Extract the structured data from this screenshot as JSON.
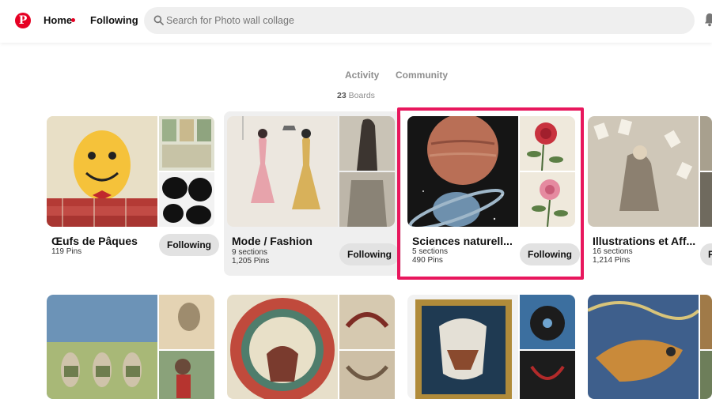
{
  "header": {
    "logo": "P",
    "home_label": "Home",
    "following_label": "Following",
    "search_placeholder": "Search for Photo wall collage"
  },
  "tabs": [
    {
      "label": "Activity"
    },
    {
      "label": "Community"
    }
  ],
  "boards_count": {
    "number": "23",
    "label": "Boards"
  },
  "boards": [
    {
      "title": "Œufs de Pâques",
      "sections": "",
      "pins": "119 Pins",
      "button": "Following"
    },
    {
      "title": "Mode / Fashion",
      "sections": "9 sections",
      "pins": "1,205 Pins",
      "button": "Following"
    },
    {
      "title": "Sciences naturell...",
      "sections": "5 sections",
      "pins": "490 Pins",
      "button": "Following"
    },
    {
      "title": "Illustrations et Aff...",
      "sections": "16 sections",
      "pins": "1,214 Pins",
      "button": "F"
    }
  ],
  "colors": {
    "brand": "#e60023",
    "highlight": "#e8175d",
    "button_bg": "#e2e2e2"
  }
}
